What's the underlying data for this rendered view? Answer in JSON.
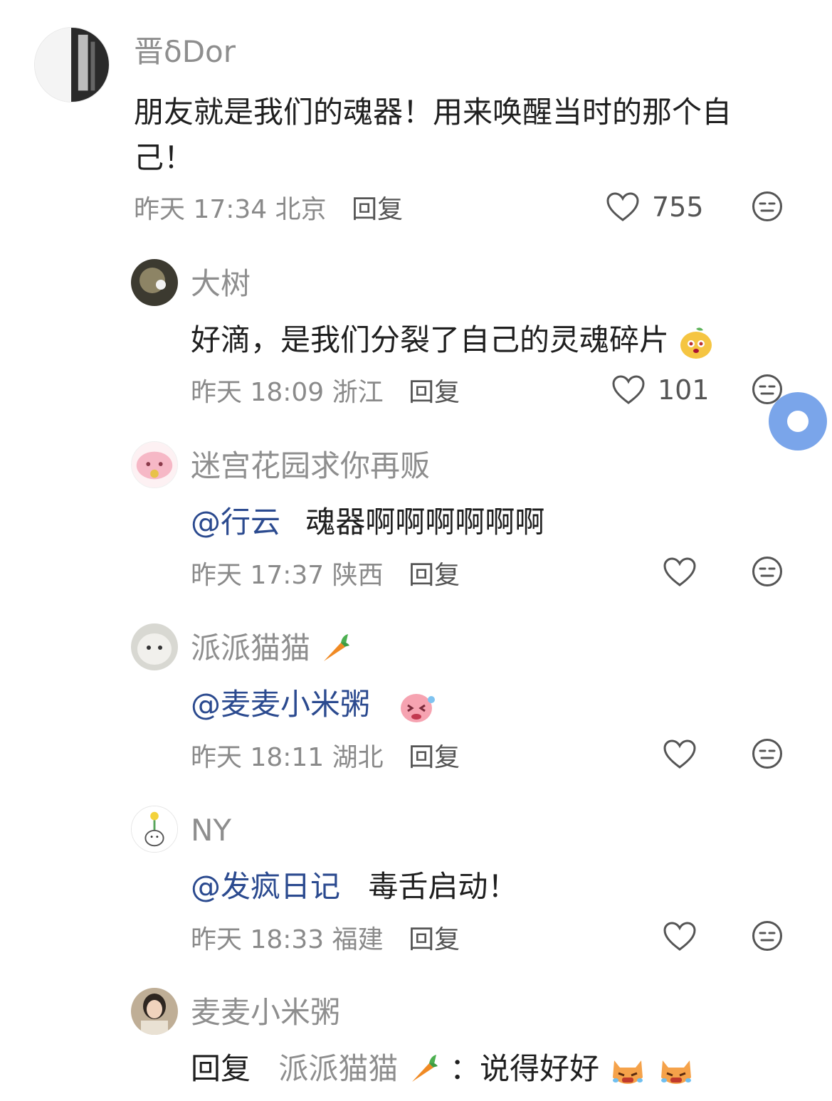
{
  "comments": [
    {
      "username": "晋δDor",
      "text": "朋友就是我们的魂器！用来唤醒当时的那个自",
      "text_line2": "己！",
      "time": "昨天 17:34",
      "location": "北京",
      "reply_label": "回复",
      "likes": "755"
    },
    {
      "username": "大树",
      "text": "好滴，是我们分裂了自己的灵魂碎片",
      "time": "昨天 18:09",
      "location": "浙江",
      "reply_label": "回复",
      "likes": "101"
    },
    {
      "username": "迷宫花园求你再贩",
      "mention": "@行云",
      "text": "魂器啊啊啊啊啊啊",
      "time": "昨天 17:37",
      "location": "陕西",
      "reply_label": "回复"
    },
    {
      "username": "派派猫猫",
      "mention": "@麦麦小米粥",
      "time": "昨天 18:11",
      "location": "湖北",
      "reply_label": "回复"
    },
    {
      "username": "NY",
      "mention": "@发疯日记",
      "text": "毒舌启动！",
      "time": "昨天 18:33",
      "location": "福建",
      "reply_label": "回复"
    },
    {
      "username": "麦麦小米粥",
      "reply_prefix": "回复",
      "reply_to": "派派猫猫",
      "text": "：说得好好"
    }
  ],
  "colors": {
    "mention": "#2b4a8f",
    "meta": "#8a8a8a",
    "username": "#8e8e8e",
    "floating_button": "#7aa5ea"
  }
}
